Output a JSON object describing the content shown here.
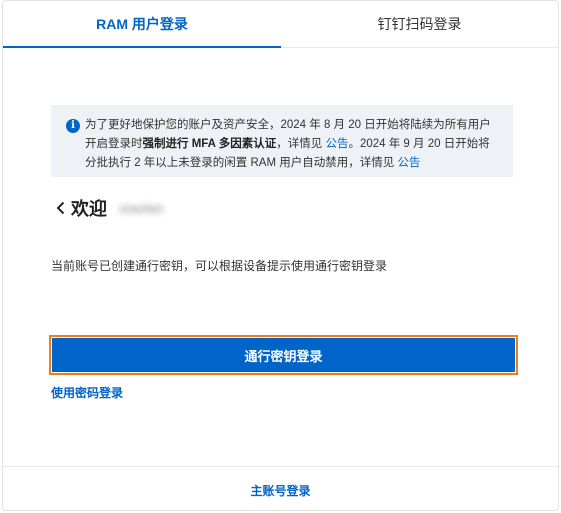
{
  "tabs": [
    {
      "label": "RAM 用户登录",
      "active": true
    },
    {
      "label": "钉钉扫码登录",
      "active": false
    }
  ],
  "notice": {
    "icon": "info-icon",
    "seg1": "为了更好地保护您的账户及资产安全，2024 年 8 月 20 日开始将陆续为所有用户开启登录时",
    "bold": "强制进行 MFA 多因素认证",
    "seg2": "，详情见 ",
    "link1": "公告",
    "seg3": "。2024 年 9 月 20 日开始将分批执行 2 年以上未登录的闲置 RAM 用户自动禁用，详情见 ",
    "link2": "公告"
  },
  "welcome": {
    "back_icon": "chevron-left-icon",
    "title": "欢迎",
    "username": "xiaolan"
  },
  "hint": "当前账号已创建通行密钥，可以根据设备提示使用通行密钥登录",
  "primary_button": "通行密钥登录",
  "password_link": "使用密码登录",
  "footer_link": "主账号登录",
  "colors": {
    "accent": "#0064c8",
    "highlight_border": "#f07d1a",
    "notice_bg": "#eef2f6"
  }
}
